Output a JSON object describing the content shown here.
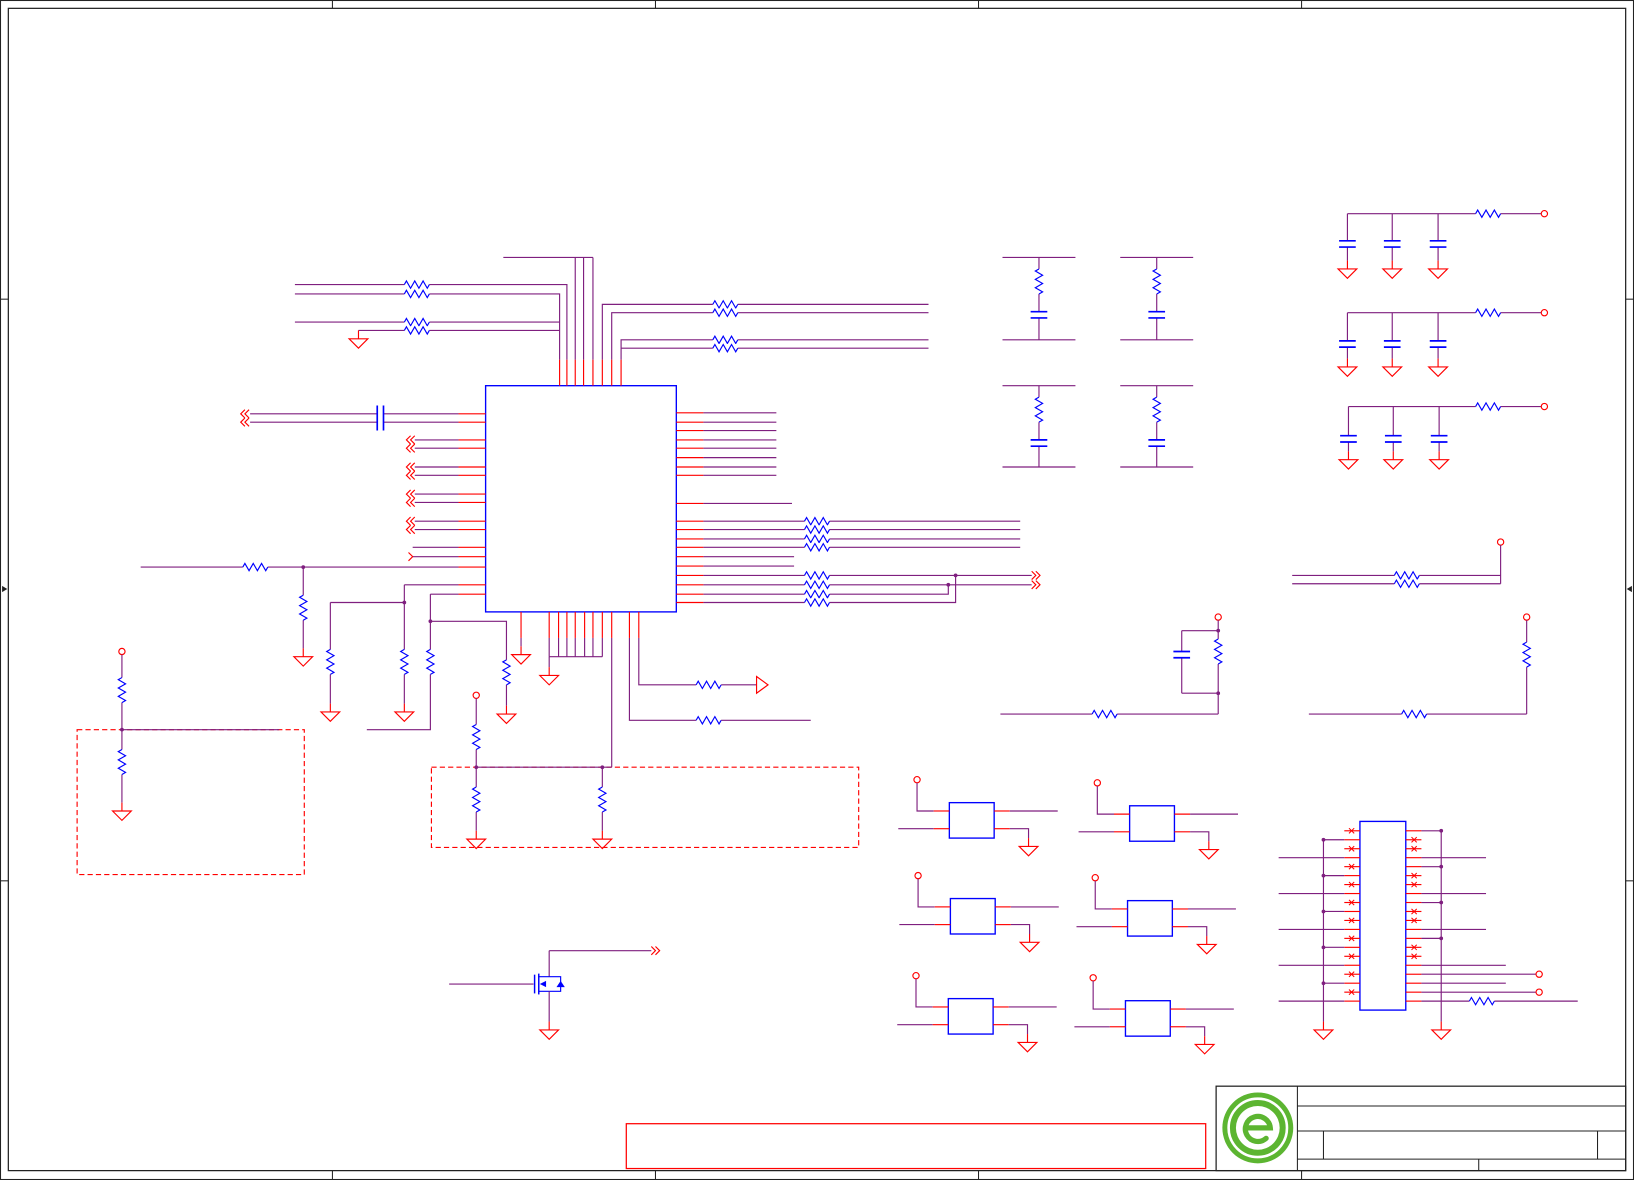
{
  "colors": {
    "wire": "#7f1f7f",
    "pin": "#ff0000",
    "component": "#0000ff",
    "frame": "#222222",
    "background": "#ffffff",
    "logo_green": "#5cb531"
  },
  "icons": {
    "logo": "company-logo-icon",
    "ground": "ground-symbol-icon",
    "power_port": "power-port-icon"
  }
}
